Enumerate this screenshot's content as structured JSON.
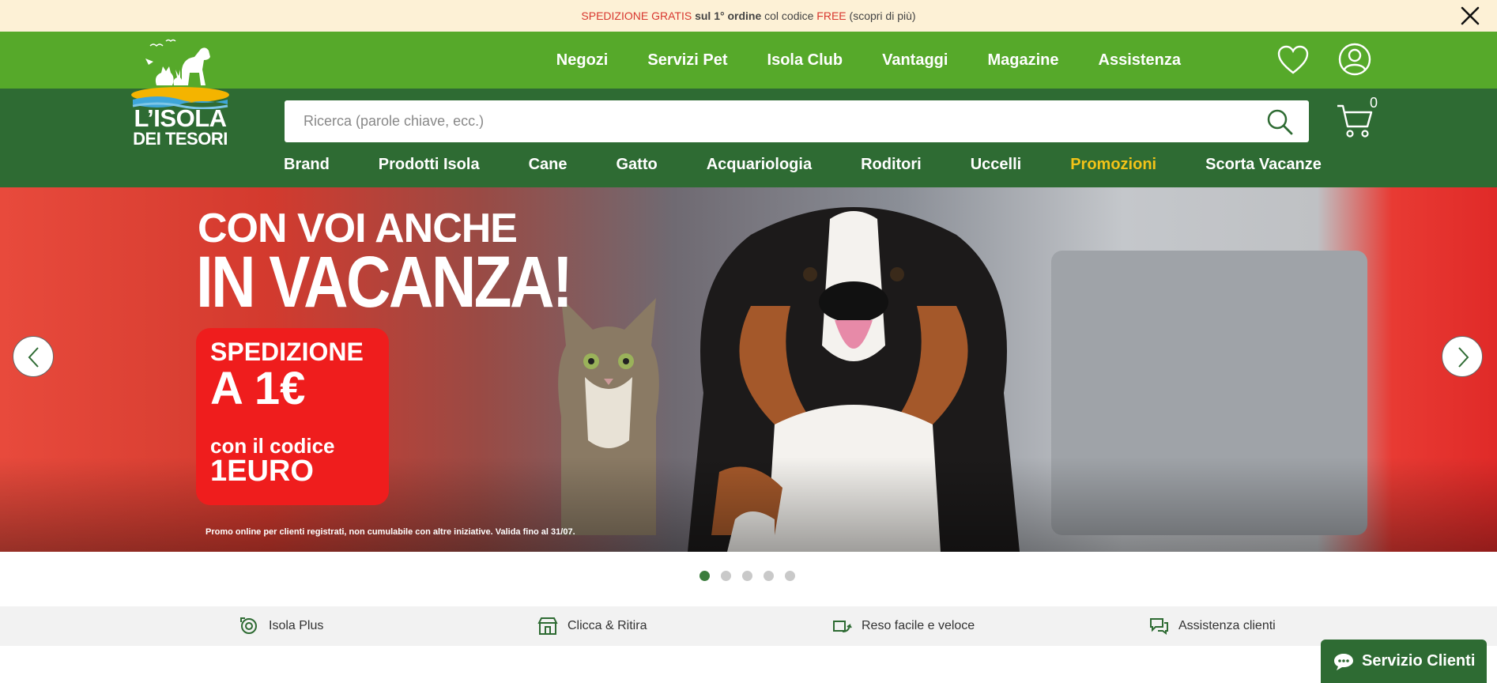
{
  "promo_bar": {
    "part1": "SPEDIZIONE GRATIS",
    "part2": " sul 1° ordine",
    "part3": " col codice ",
    "part4": "FREE",
    "part5": " (scopri di più)",
    "close_icon": "close-icon"
  },
  "top_nav": {
    "items": [
      "Negozi",
      "Servizi Pet",
      "Isola Club",
      "Vantaggi",
      "Magazine",
      "Assistenza"
    ],
    "wishlist_icon": "heart-icon",
    "account_icon": "user-icon"
  },
  "logo": {
    "line1": "L’ISOLA",
    "line2": "DEI TESORI"
  },
  "search": {
    "placeholder": "Ricerca (parole chiave, ecc.)",
    "icon": "search-icon"
  },
  "cart": {
    "count": "0",
    "icon": "cart-icon"
  },
  "categories": {
    "items": [
      "Brand",
      "Prodotti Isola",
      "Cane",
      "Gatto",
      "Acquariologia",
      "Roditori",
      "Uccelli",
      "Promozioni",
      "Scorta Vacanze"
    ],
    "highlight_color": "#f2c318"
  },
  "hero": {
    "title1": "CON VOI ANCHE",
    "title2": "IN VACANZA!",
    "box_line1": "SPEDIZIONE",
    "box_line2": "A 1€",
    "box_line3": "con il codice",
    "box_line4": "1EURO",
    "note": "Promo online per clienti registrati, non cumulabile con altre iniziative. Valida fino al 31/07.",
    "prev_icon": "chevron-left-icon",
    "next_icon": "chevron-right-icon"
  },
  "carousel": {
    "slides": 5,
    "active": 1,
    "active_color": "#3b7d3d"
  },
  "features": [
    "Isola Plus",
    "Clicca & Ritira",
    "Reso facile e veloce",
    "Assistenza clienti"
  ],
  "chat": {
    "label": "Servizio Clienti",
    "icon": "chat-icon"
  },
  "colors": {
    "green": "#56a92a",
    "dark_green": "#2e6b33",
    "promo_bg": "#fdf1d6",
    "red": "#d8372f"
  }
}
